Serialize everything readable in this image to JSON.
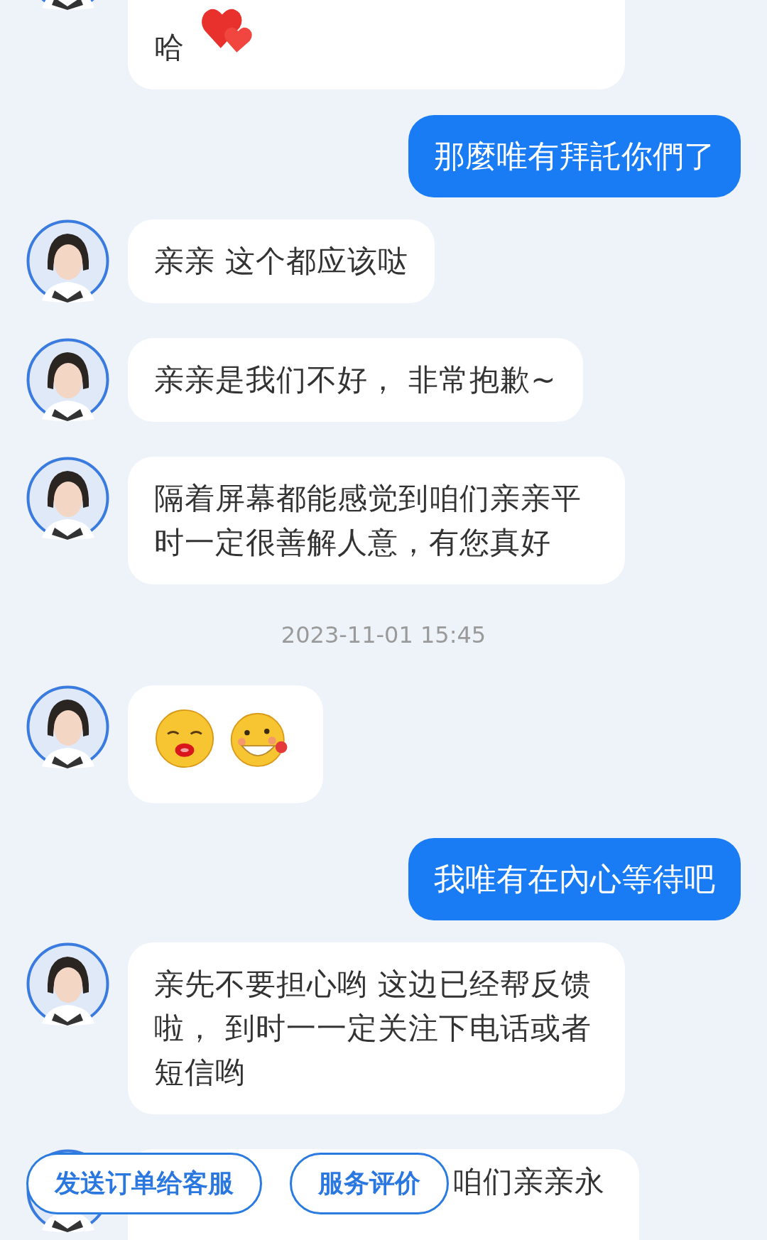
{
  "messages": [
    {
      "kind": "in_sticker",
      "text": "哈"
    },
    {
      "kind": "out",
      "text": "那麼唯有拜託你們了"
    },
    {
      "kind": "in",
      "text": "亲亲 这个都应该哒"
    },
    {
      "kind": "in",
      "text": "亲亲是我们不好， 非常抱歉~"
    },
    {
      "kind": "in",
      "text": "隔着屏幕都能感觉到咱们亲亲平时一定很善解人意，有您真好"
    },
    {
      "kind": "time",
      "text": "2023-11-01 15:45"
    },
    {
      "kind": "stickers"
    },
    {
      "kind": "out",
      "text": "我唯有在內心等待吧"
    },
    {
      "kind": "in",
      "text": "亲先不要担心哟 这边已经帮反馈啦， 到时一一定关注下电话或者短信哟"
    },
    {
      "kind": "in_covered",
      "lines": [
        [
          "咱们亲亲永"
        ]
      ]
    }
  ],
  "actions": [
    "发送订单给客服",
    "服务评价"
  ]
}
